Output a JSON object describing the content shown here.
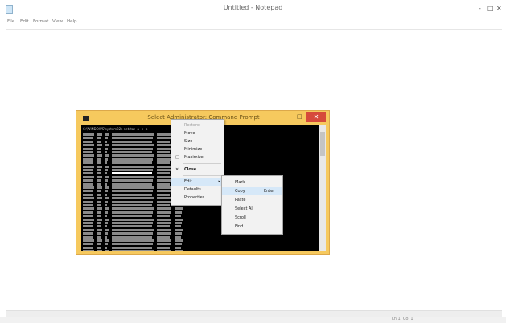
{
  "notepad": {
    "title": "Untitled - Notepad",
    "controls": {
      "minimize": "-",
      "maximize": "□",
      "close": "✕"
    },
    "menus": [
      "File",
      "Edit",
      "Format",
      "View",
      "Help"
    ],
    "status": "Ln 1, Col 1"
  },
  "console": {
    "title": "Select Administrator: Command Prompt",
    "header_line": "C:\\WINDOWS\\system32>netstat -a -n -o",
    "controls": {
      "minimize": "–",
      "maximize": "□",
      "close": "✕"
    }
  },
  "system_menu": {
    "items": [
      {
        "label": "Restore",
        "disabled": true
      },
      {
        "label": "Move",
        "disabled": false
      },
      {
        "label": "Size",
        "disabled": false
      },
      {
        "label": "Minimize",
        "disabled": false,
        "mark": "–"
      },
      {
        "label": "Maximize",
        "disabled": false,
        "mark": "□"
      },
      {
        "label": "Close",
        "disabled": false,
        "mark": "✕"
      },
      {
        "label": "Edit",
        "disabled": false,
        "submenu": true,
        "active": true
      },
      {
        "label": "Defaults",
        "disabled": false
      },
      {
        "label": "Properties",
        "disabled": false
      }
    ]
  },
  "edit_submenu": {
    "items": [
      {
        "label": "Mark"
      },
      {
        "label": "Copy",
        "shortcut": "Enter",
        "active": true
      },
      {
        "label": "Paste"
      },
      {
        "label": "Select All"
      },
      {
        "label": "Scroll"
      },
      {
        "label": "Find..."
      }
    ]
  },
  "colors": {
    "console_frame": "#f6c95e",
    "console_close": "#d64a3b",
    "menu_highlight": "#d6e8f8"
  }
}
